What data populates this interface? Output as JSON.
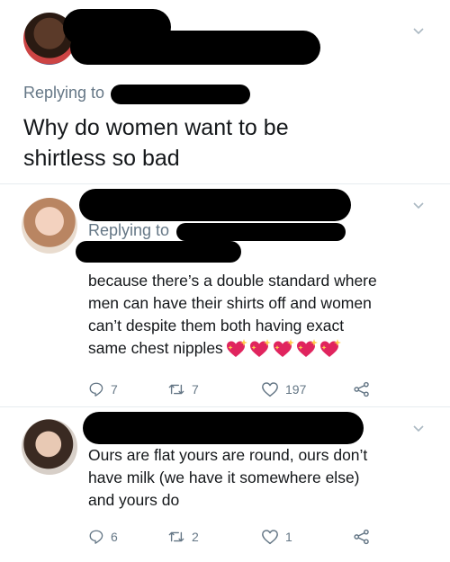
{
  "tweet1": {
    "replying_prefix": "Replying to",
    "text_line1": "Why do women want to be",
    "text_line2": "shirtless so bad"
  },
  "tweet2": {
    "replying_prefix": "Replying to",
    "text_lines": [
      "because there’s a double standard where",
      "men can have their shirts off and women",
      "can’t despite them both having exact",
      "same chest nipples"
    ],
    "emoji_count": 5,
    "actions": {
      "replies": "7",
      "retweets": "7",
      "likes": "197"
    }
  },
  "tweet3": {
    "text_lines": [
      "Ours are flat yours are round, ours don’t",
      "have milk (we have it somewhere else)",
      "and yours do"
    ],
    "actions": {
      "replies": "6",
      "retweets": "2",
      "likes": "1"
    }
  },
  "colors": {
    "text": "#14171a",
    "secondary": "#657786",
    "divider": "#e6ecf0",
    "emoji_heart": "#e0245e"
  },
  "icons": [
    "chevron-down-icon",
    "reply-icon",
    "retweet-icon",
    "like-icon",
    "share-icon",
    "sparkling-heart-icon"
  ]
}
